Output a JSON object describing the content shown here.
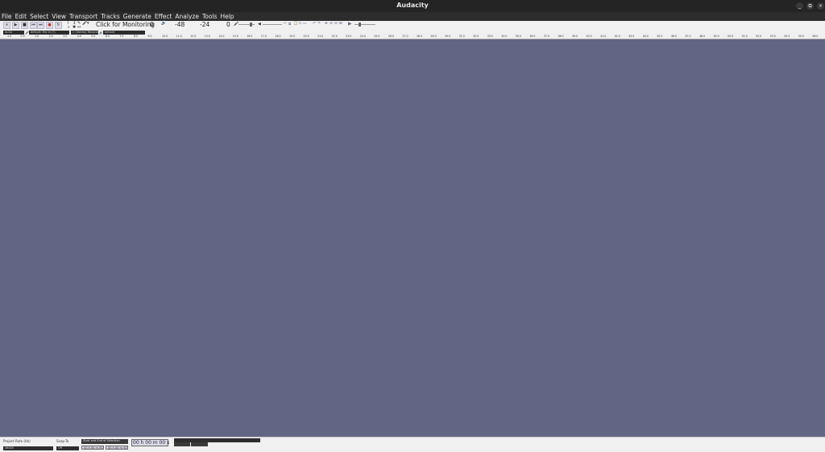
{
  "window": {
    "title": "Audacity",
    "controls": [
      "_",
      "⧉",
      "×"
    ]
  },
  "menubar": {
    "items": [
      "File",
      "Edit",
      "Select",
      "View",
      "Transport",
      "Tracks",
      "Generate",
      "Effect",
      "Analyze",
      "Tools",
      "Help"
    ]
  },
  "transport": {
    "pause": "⏸",
    "play": "▶",
    "stop": "■",
    "skip_start": "⏮",
    "skip_end": "⏭",
    "record": "●",
    "loop": "↻"
  },
  "tools": {
    "select": "I",
    "envelope": "↕",
    "draw": "✎",
    "zoom": "⌕",
    "multi": "✱",
    "timeshift": "↔"
  },
  "meter": {
    "monitor_label": "Click for Monitoring",
    "scale_0a": "0",
    "scale_m48": "-48",
    "scale_m24": "-24",
    "scale_0b": "0"
  },
  "device": {
    "host": "ALSA",
    "recording_device": "default: Mic In (?)",
    "channels": "2 (Stereo) Recordin",
    "playback_device": "default"
  },
  "ruler": {
    "ticks": [
      "-1.0",
      "0.0",
      "1.0",
      "2.0",
      "3.0",
      "4.0",
      "5.0",
      "6.0",
      "7.0",
      "8.0",
      "9.0",
      "10.0",
      "11.0",
      "12.0",
      "13.0",
      "14.0",
      "15.0",
      "16.0",
      "17.0",
      "18.0",
      "19.0",
      "20.0",
      "21.0",
      "22.0",
      "23.0",
      "24.0",
      "25.0",
      "26.0",
      "27.0",
      "28.0",
      "29.0",
      "30.0",
      "31.0",
      "32.0",
      "33.0",
      "34.0",
      "35.0",
      "36.0",
      "37.0",
      "38.0",
      "39.0",
      "40.0",
      "41.0",
      "42.0",
      "43.0",
      "44.0",
      "45.0",
      "46.0",
      "47.0",
      "48.0",
      "49.0",
      "50.0",
      "51.0",
      "52.0",
      "53.0",
      "54.0",
      "55.0",
      "56.0",
      "57.0",
      "58.0"
    ]
  },
  "selection": {
    "project_rate_label": "Project Rate (Hz)",
    "project_rate": "48000",
    "snap_to_label": "Snap-To",
    "snap_to": "Off",
    "selection_mode": "Start and End of Selection",
    "start": "00 h 00 m 00.000 s",
    "end": "00 h 00 m 00.000 s",
    "audio_position": "00 h 00 m 00 s"
  },
  "colors": {
    "track_bg": "#636584",
    "titlebar": "#242424",
    "toolbar": "#f0f0f0"
  }
}
